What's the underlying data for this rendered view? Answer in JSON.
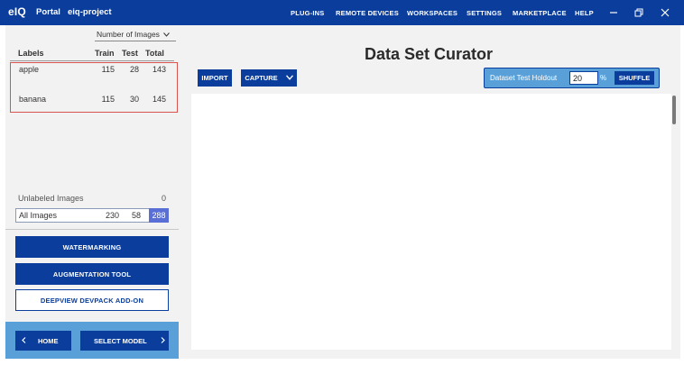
{
  "app": {
    "logo": "eIQ",
    "name": "Portal",
    "project": "eiq-project"
  },
  "nav": [
    "PLUG-INS",
    "REMOTE DEVICES",
    "WORKSPACES",
    "SETTINGS",
    "MARKETPLACE",
    "HELP"
  ],
  "window_controls": [
    "minimize-icon",
    "restore-icon",
    "close-icon"
  ],
  "left": {
    "count_select": "Number of Images",
    "columns": {
      "labels": "Labels",
      "train": "Train",
      "test": "Test",
      "total": "Total"
    },
    "rows": [
      {
        "label": "apple",
        "train": "115",
        "test": "28",
        "total": "143"
      },
      {
        "label": "banana",
        "train": "115",
        "test": "30",
        "total": "145"
      }
    ],
    "unlabeled": {
      "label": "Unlabeled Images",
      "value": "0"
    },
    "all": {
      "label": "All Images",
      "train": "230",
      "test": "58",
      "total": "288"
    },
    "buttons": {
      "watermarking": "WATERMARKING",
      "augmentation": "AUGMENTATION TOOL",
      "deepview": "DEEPVIEW DEVPACK ADD-ON"
    },
    "footer": {
      "home": "HOME",
      "select_model": "SELECT MODEL"
    }
  },
  "main": {
    "title": "Data Set Curator",
    "import": "IMPORT",
    "capture": "CAPTURE",
    "holdout_label": "Dataset Test Holdout",
    "holdout_value": "20",
    "percent": "%",
    "shuffle": "SHUFFLE"
  },
  "colors": {
    "primary": "#0a3d9c",
    "accent": "#5aa0d8",
    "highlight": "#5a6fd6",
    "selection_border": "#d9534f"
  }
}
